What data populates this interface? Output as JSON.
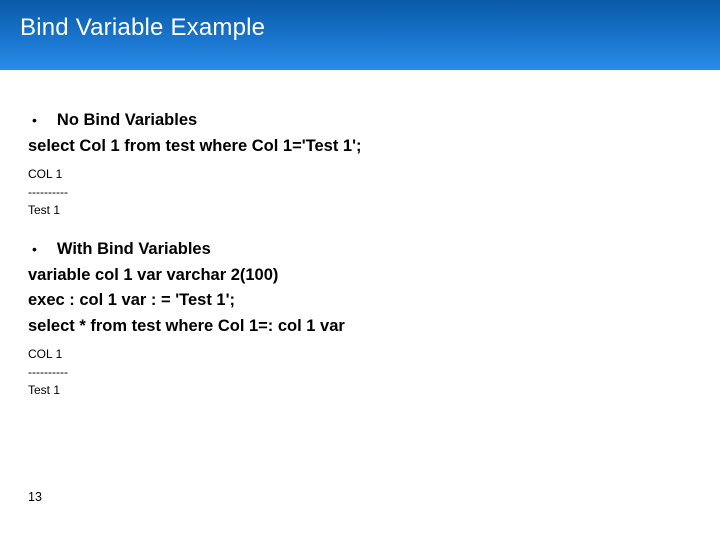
{
  "header": {
    "title": "Bind Variable Example"
  },
  "sections": {
    "noBind": {
      "bullet_label": "No Bind Variables",
      "query": "select Col 1 from test where Col 1='Test 1';",
      "out_col": "COL 1",
      "out_sep": "----------",
      "out_val": "Test 1"
    },
    "withBind": {
      "bullet_label": "With Bind Variables",
      "line_var": "variable col 1 var varchar 2(100)",
      "line_exec": "exec : col 1 var : = 'Test 1';",
      "line_select": "select * from test where Col 1=: col 1 var",
      "out_col": "COL 1",
      "out_sep": "----------",
      "out_val": "Test 1"
    }
  },
  "page_number": "13"
}
